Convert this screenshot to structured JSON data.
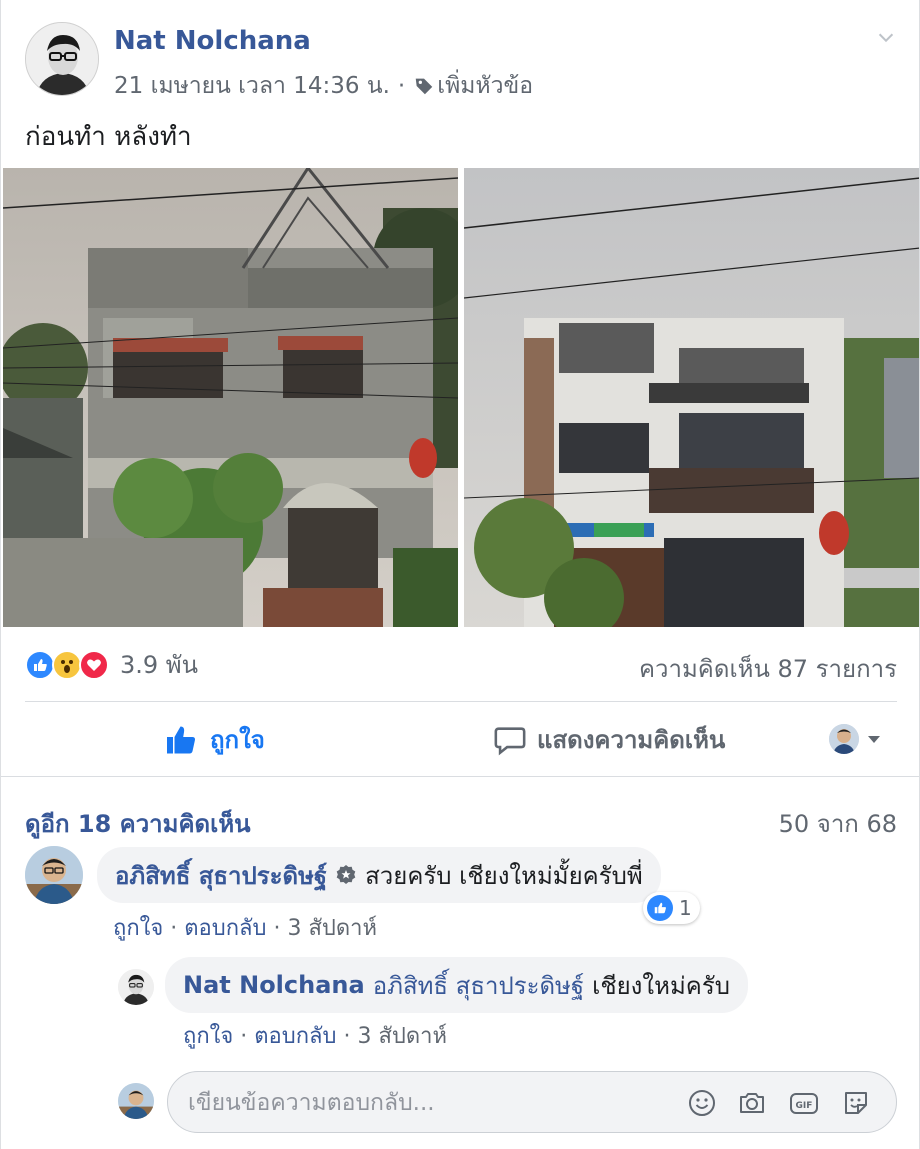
{
  "post": {
    "author": "Nat Nolchana",
    "date": "21 เมษายน เวลา 14:36 น.",
    "separator": "·",
    "add_topic": "เพิ่มหัวข้อ",
    "text": "ก่อนทำ หลังทำ"
  },
  "stats": {
    "reaction_count": "3.9 พัน",
    "comment_count": "ความคิดเห็น 87 รายการ"
  },
  "actions": {
    "like": "ถูกใจ",
    "comment": "แสดงความคิดเห็น"
  },
  "comments_section": {
    "more_link": "ดูอีก 18 ความคิดเห็น",
    "paging": "50 จาก 68",
    "comments": [
      {
        "author": "อภิสิทธิ์ สุธาประดิษฐ์",
        "text": "สวยครับ เชียงใหม่มั้ยครับพี่",
        "like": "ถูกใจ",
        "reply": "ตอบกลับ",
        "time": "3 สัปดาห์",
        "reaction_count": "1"
      }
    ],
    "reply": {
      "author": "Nat Nolchana",
      "mention": "อภิสิทธิ์ สุธาประดิษฐ์",
      "text": "เชียงใหม่ครับ",
      "like": "ถูกใจ",
      "reply": "ตอบกลับ",
      "time": "3 สัปดาห์"
    },
    "reply_input": {
      "placeholder": "เขียนข้อความตอบกลับ..."
    },
    "action_sep": " · "
  },
  "colors": {
    "link": "#385898",
    "accent": "#1877f2",
    "muted": "#606770",
    "like_reaction": "#2d88ff",
    "love_reaction": "#f02849",
    "wow_reaction": "#f7c53e"
  },
  "icons": [
    "tag-icon",
    "chevron-down-icon",
    "like-reaction-icon",
    "wow-reaction-icon",
    "love-reaction-icon",
    "thumbs-up-icon",
    "comment-bubble-icon",
    "verified-badge-icon",
    "emoji-icon",
    "camera-icon",
    "gif-icon",
    "sticker-icon"
  ]
}
